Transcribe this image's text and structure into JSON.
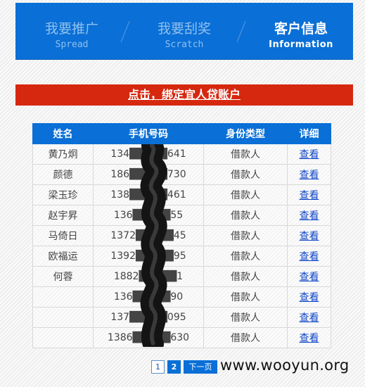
{
  "nav": {
    "items": [
      {
        "zh": "我要推广",
        "en": "Spread",
        "active": false
      },
      {
        "zh": "我要刮奖",
        "en": "Scratch",
        "active": false
      },
      {
        "zh": "客户信息",
        "en": "Information",
        "active": true
      }
    ]
  },
  "banner": {
    "link_text": "点击，绑定宜人贷账户"
  },
  "table": {
    "headers": [
      "姓名",
      "手机号码",
      "身份类型",
      "详细"
    ],
    "rows": [
      {
        "name": "黄乃炯",
        "phone": "134█████641",
        "type": "借款人",
        "action": "查看"
      },
      {
        "name": "颜德",
        "phone": "186█████730",
        "type": "借款人",
        "action": "查看"
      },
      {
        "name": "梁玉珍",
        "phone": "138█████461",
        "type": "借款人",
        "action": "查看"
      },
      {
        "name": "赵宇昇",
        "phone": "136█████55",
        "type": "借款人",
        "action": "查看"
      },
      {
        "name": "马倚日",
        "phone": "1372█████45",
        "type": "借款人",
        "action": "查看"
      },
      {
        "name": "欧福运",
        "phone": "1392█████95",
        "type": "借款人",
        "action": "查看"
      },
      {
        "name": "何蓉",
        "phone": "1882█████1",
        "type": "借款人",
        "action": "查看"
      },
      {
        "name": "",
        "phone": "136█████90",
        "type": "借款人",
        "action": "查看"
      },
      {
        "name": "",
        "phone": "137█████095",
        "type": "借款人",
        "action": "查看"
      },
      {
        "name": "",
        "phone": "1386█████630",
        "type": "借款人",
        "action": "查看"
      }
    ]
  },
  "pager": {
    "page1": "1",
    "page2": "2",
    "next": "下一页"
  },
  "watermark": "www.wooyun.org"
}
